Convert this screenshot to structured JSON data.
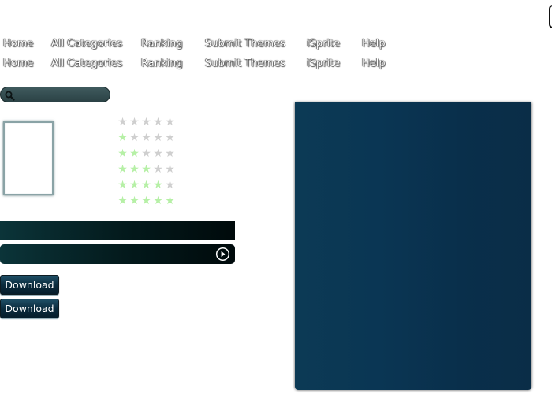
{
  "nav": {
    "items": [
      "Home",
      "All Categories",
      "Ranking",
      "Submit Themes",
      "iSprite",
      "Help"
    ]
  },
  "search": {
    "placeholder": "",
    "icon": "search-icon"
  },
  "ratings": [
    0,
    1,
    2,
    3,
    4,
    5
  ],
  "rating_max": 5,
  "buttons": {
    "download_1": "Download",
    "download_2": "Download"
  },
  "colors": {
    "star_filled": "#b6f0a6",
    "star_empty": "#cfcfcf",
    "panel": "#0a3654",
    "button": "#0b2c3e"
  }
}
